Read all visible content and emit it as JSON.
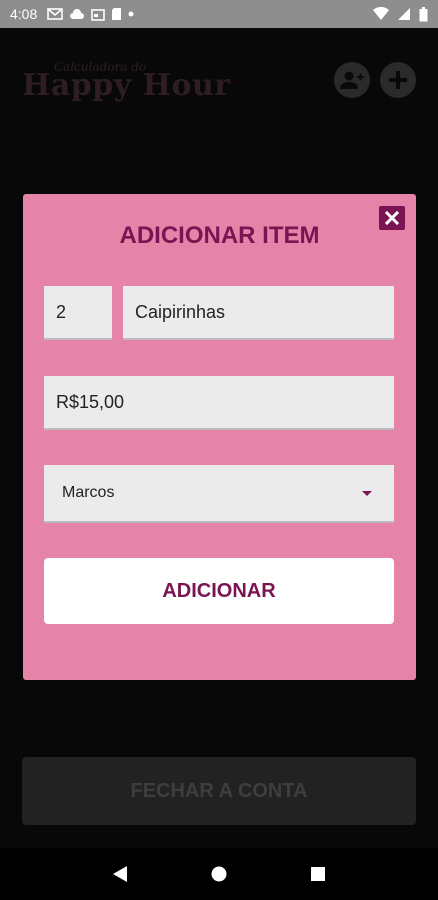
{
  "status_bar": {
    "time": "4:08"
  },
  "header": {
    "logo_top": "Calculadora do",
    "logo_main": "Happy Hour"
  },
  "modal": {
    "title": "ADICIONAR ITEM",
    "quantity": "2",
    "item_name": "Caipirinhas",
    "price": "R$15,00",
    "person": "Marcos",
    "add_button": "ADICIONAR"
  },
  "footer": {
    "close_bill": "FECHAR A CONTA"
  },
  "colors": {
    "accent": "#7b1452",
    "modal_bg": "#e584a8",
    "field_bg": "#ebebeb"
  }
}
